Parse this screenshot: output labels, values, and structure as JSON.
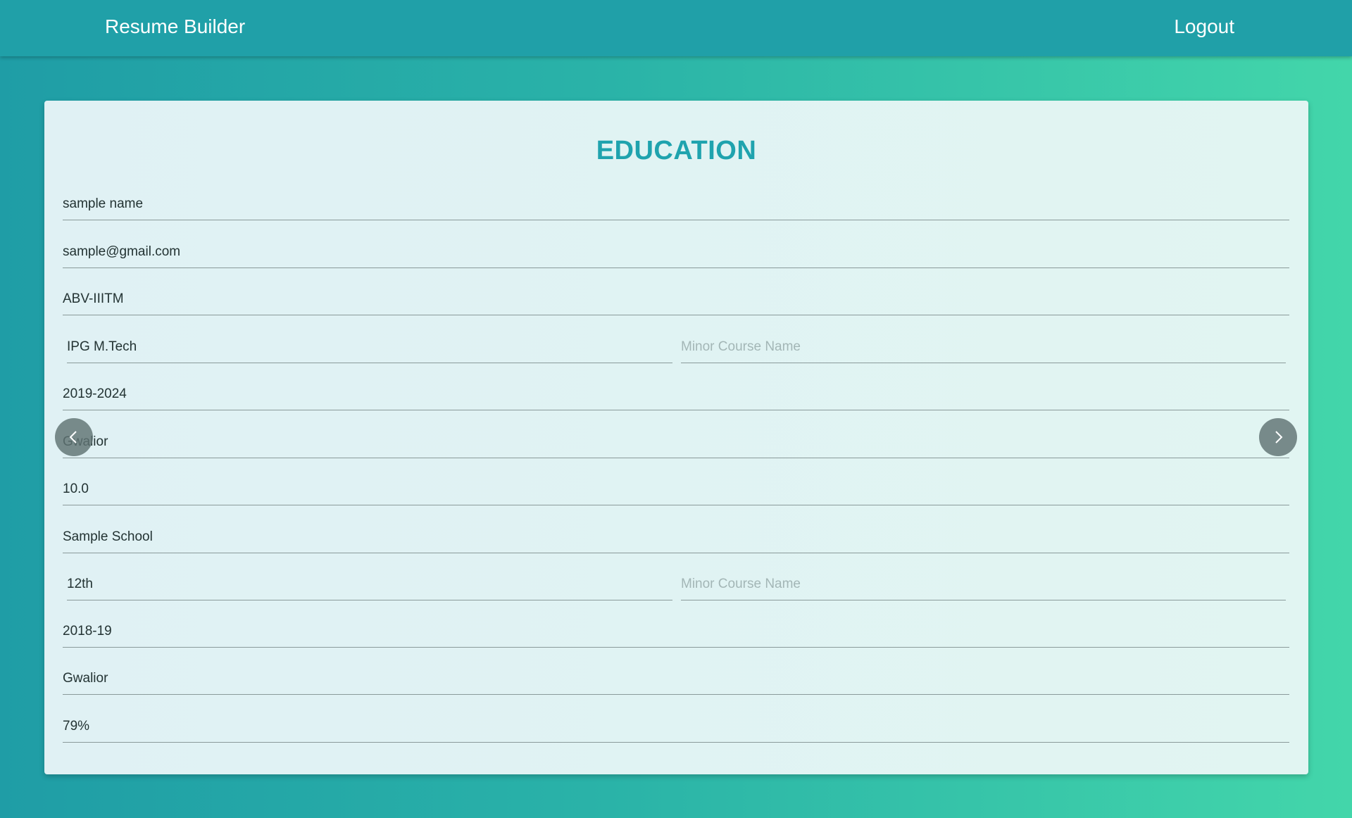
{
  "navbar": {
    "brand": "Resume Builder",
    "logout_label": "Logout"
  },
  "section": {
    "title": "EDUCATION"
  },
  "fields": {
    "name": {
      "value": "sample name",
      "placeholder": ""
    },
    "email": {
      "value": "sample@gmail.com",
      "placeholder": ""
    },
    "college": {
      "value": "ABV-IIITM",
      "placeholder": ""
    },
    "college_course": {
      "value": "IPG M.Tech",
      "placeholder": ""
    },
    "college_minor": {
      "value": "",
      "placeholder": "Minor Course Name"
    },
    "college_year": {
      "value": "2019-2024",
      "placeholder": ""
    },
    "college_location": {
      "value": "Gwalior",
      "placeholder": ""
    },
    "college_score": {
      "value": "10.0",
      "placeholder": ""
    },
    "school": {
      "value": "Sample School",
      "placeholder": ""
    },
    "school_course": {
      "value": "12th",
      "placeholder": ""
    },
    "school_minor": {
      "value": "",
      "placeholder": "Minor Course Name"
    },
    "school_year": {
      "value": "2018-19",
      "placeholder": ""
    },
    "school_location": {
      "value": "Gwalior",
      "placeholder": ""
    },
    "school_score": {
      "value": "79%",
      "placeholder": ""
    }
  },
  "carousel": {
    "prev_icon": "chevron-left-icon",
    "next_icon": "chevron-right-icon"
  },
  "colors": {
    "navbar": "#20a0a8",
    "title": "#1fa3ae",
    "gradient_start": "#1f9da6",
    "gradient_end": "#43d6aa"
  }
}
